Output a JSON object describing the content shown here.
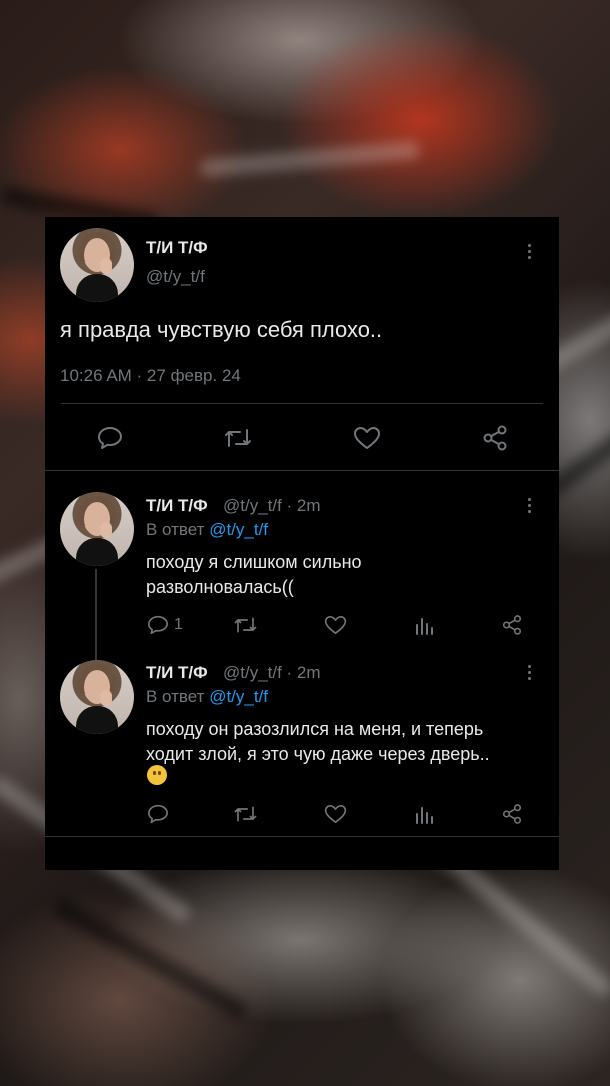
{
  "main_tweet": {
    "author_name": "Т/И Т/Ф",
    "handle": "@t/y_t/f",
    "text": "я правда чувствую себя плохо..",
    "timestamp": "10:26 AM · 27 февр. 24"
  },
  "replies": [
    {
      "author_name": "Т/И Т/Ф",
      "handle_time": "@t/y_t/f · 2m",
      "reply_prefix": "В ответ",
      "reply_to": "@t/y_t/f",
      "text_lines": [
        "походу я слишком сильно",
        "разволновалась(("
      ],
      "reply_count": "1"
    },
    {
      "author_name": "Т/И Т/Ф",
      "handle_time": "@t/y_t/f · 2m",
      "reply_prefix": "В ответ",
      "reply_to": "@t/y_t/f",
      "text_lines": [
        "походу он разозлился на меня, и теперь",
        "ходит злой, я это чую даже через дверь.."
      ],
      "emoji": "face-without-mouth"
    }
  ],
  "icons": {
    "reply": "comment-icon",
    "retweet": "retweet-icon",
    "like": "heart-icon",
    "views": "stats-icon",
    "share": "share-icon",
    "more": "more-icon"
  },
  "colors": {
    "background": "#000000",
    "primary_text": "#e7e9ea",
    "secondary_text": "#71767b",
    "link": "#1d9bf0"
  }
}
